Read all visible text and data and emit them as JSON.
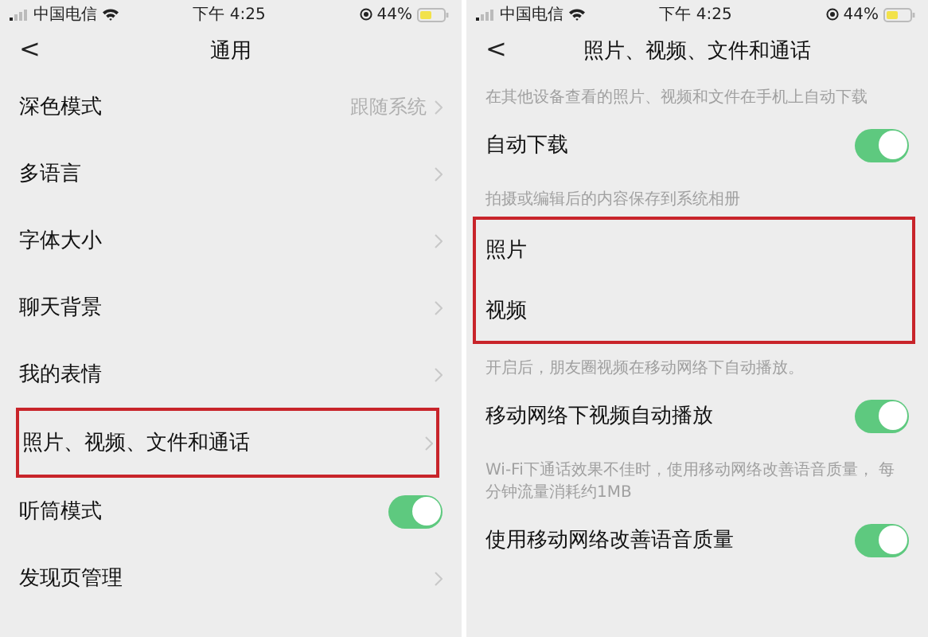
{
  "screens": [
    {
      "status_bar": {
        "carrier": "中国电信",
        "time": "下午 4:25",
        "battery": "44%"
      },
      "nav": {
        "back": "<",
        "title": "通用"
      },
      "items": [
        {
          "kind": "link",
          "label": "深色模式",
          "value": "跟随系统",
          "highlighted": false
        },
        {
          "kind": "link",
          "label": "多语言",
          "highlighted": false
        },
        {
          "kind": "link",
          "label": "字体大小",
          "highlighted": false
        },
        {
          "kind": "link",
          "label": "聊天背景",
          "highlighted": false
        },
        {
          "kind": "link",
          "label": "我的表情",
          "highlighted": false
        },
        {
          "kind": "link",
          "label": "照片、视频、文件和通话",
          "highlighted": true
        },
        {
          "kind": "switch",
          "label": "听筒模式",
          "on": true,
          "highlighted": false
        },
        {
          "kind": "link",
          "label": "发现页管理",
          "highlighted": false
        }
      ]
    },
    {
      "status_bar": {
        "carrier": "中国电信",
        "time": "下午 4:25",
        "battery": "44%"
      },
      "nav": {
        "back": "<",
        "title": "照片、视频、文件和通话"
      },
      "items": [
        {
          "kind": "caption",
          "label": "在其他设备查看的照片、视频和文件在手机上自动下载"
        },
        {
          "kind": "switch",
          "label": "自动下载",
          "on": true,
          "highlighted": false
        },
        {
          "kind": "caption",
          "label": "拍摄或编辑后的内容保存到系统相册"
        },
        {
          "kind": "group",
          "highlighted": true,
          "children": [
            {
              "label": "照片"
            },
            {
              "label": "视频"
            }
          ]
        },
        {
          "kind": "caption",
          "label": "开启后，朋友圈视频在移动网络下自动播放。"
        },
        {
          "kind": "switch",
          "label": "移动网络下视频自动播放",
          "on": true,
          "highlighted": false
        },
        {
          "kind": "caption",
          "label": "Wi-Fi下通话效果不佳时，使用移动网络改善语音质量， 每分钟流量消耗约1MB"
        },
        {
          "kind": "switch",
          "label": "使用移动网络改善语音质量",
          "on": true,
          "highlighted": false
        }
      ]
    }
  ]
}
